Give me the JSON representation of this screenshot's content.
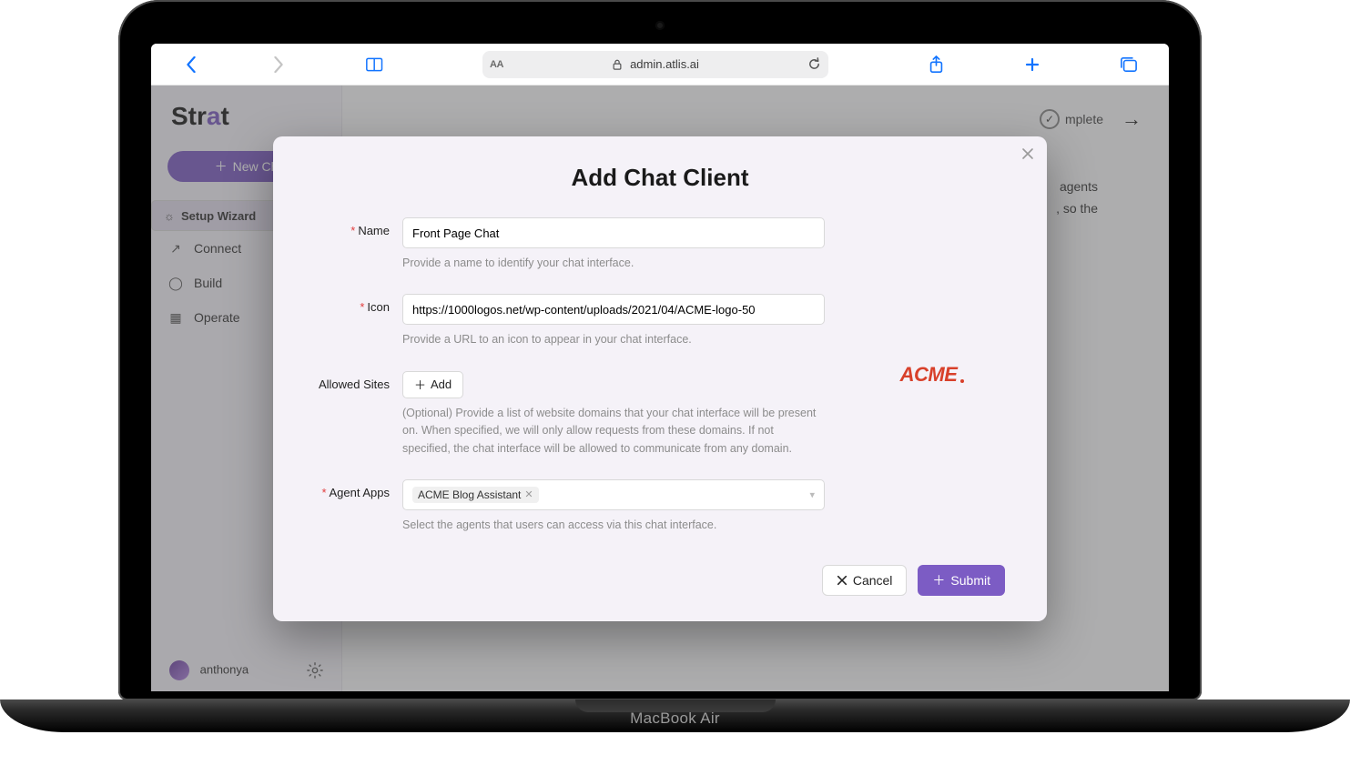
{
  "browser": {
    "aa": "AA",
    "url": "admin.atlis.ai"
  },
  "device": {
    "brand": "MacBook Air"
  },
  "sidebar": {
    "brand_pre": "Str",
    "brand_a": "a",
    "brand_post": "t",
    "new_chat": "New Ch",
    "items": [
      {
        "icon": "✲",
        "label": "Setup Wizard",
        "selected": true
      },
      {
        "icon": "⟲",
        "label": "Connect",
        "selected": false
      },
      {
        "icon": "◯",
        "label": "Build",
        "selected": false
      },
      {
        "icon": "▦",
        "label": "Operate",
        "selected": false
      }
    ],
    "user": "anthonya"
  },
  "wizard": {
    "complete": "mplete",
    "arrow": "→"
  },
  "main_text_1": "agents",
  "main_text_2": ", so the",
  "modal": {
    "title": "Add Chat Client",
    "fields": {
      "name": {
        "label": "Name",
        "value": "Front Page Chat",
        "help": "Provide a name to identify your chat interface.",
        "required": true
      },
      "icon": {
        "label": "Icon",
        "value": "https://1000logos.net/wp-content/uploads/2021/04/ACME-logo-50",
        "help": "Provide a URL to an icon to appear in your chat interface.",
        "required": true
      },
      "allowed_sites": {
        "label": "Allowed Sites",
        "add_label": "Add",
        "help": "(Optional) Provide a list of website domains that your chat interface will be present on. When specified, we will only allow requests from these domains. If not specified, the chat interface will be allowed to communicate from any domain.",
        "required": false
      },
      "agent_apps": {
        "label": "Agent Apps",
        "selected": "ACME Blog Assistant",
        "help": "Select the agents that users can access via this chat interface.",
        "required": true
      }
    },
    "preview_logo": "ACME",
    "actions": {
      "cancel": "Cancel",
      "submit": "Submit"
    }
  }
}
